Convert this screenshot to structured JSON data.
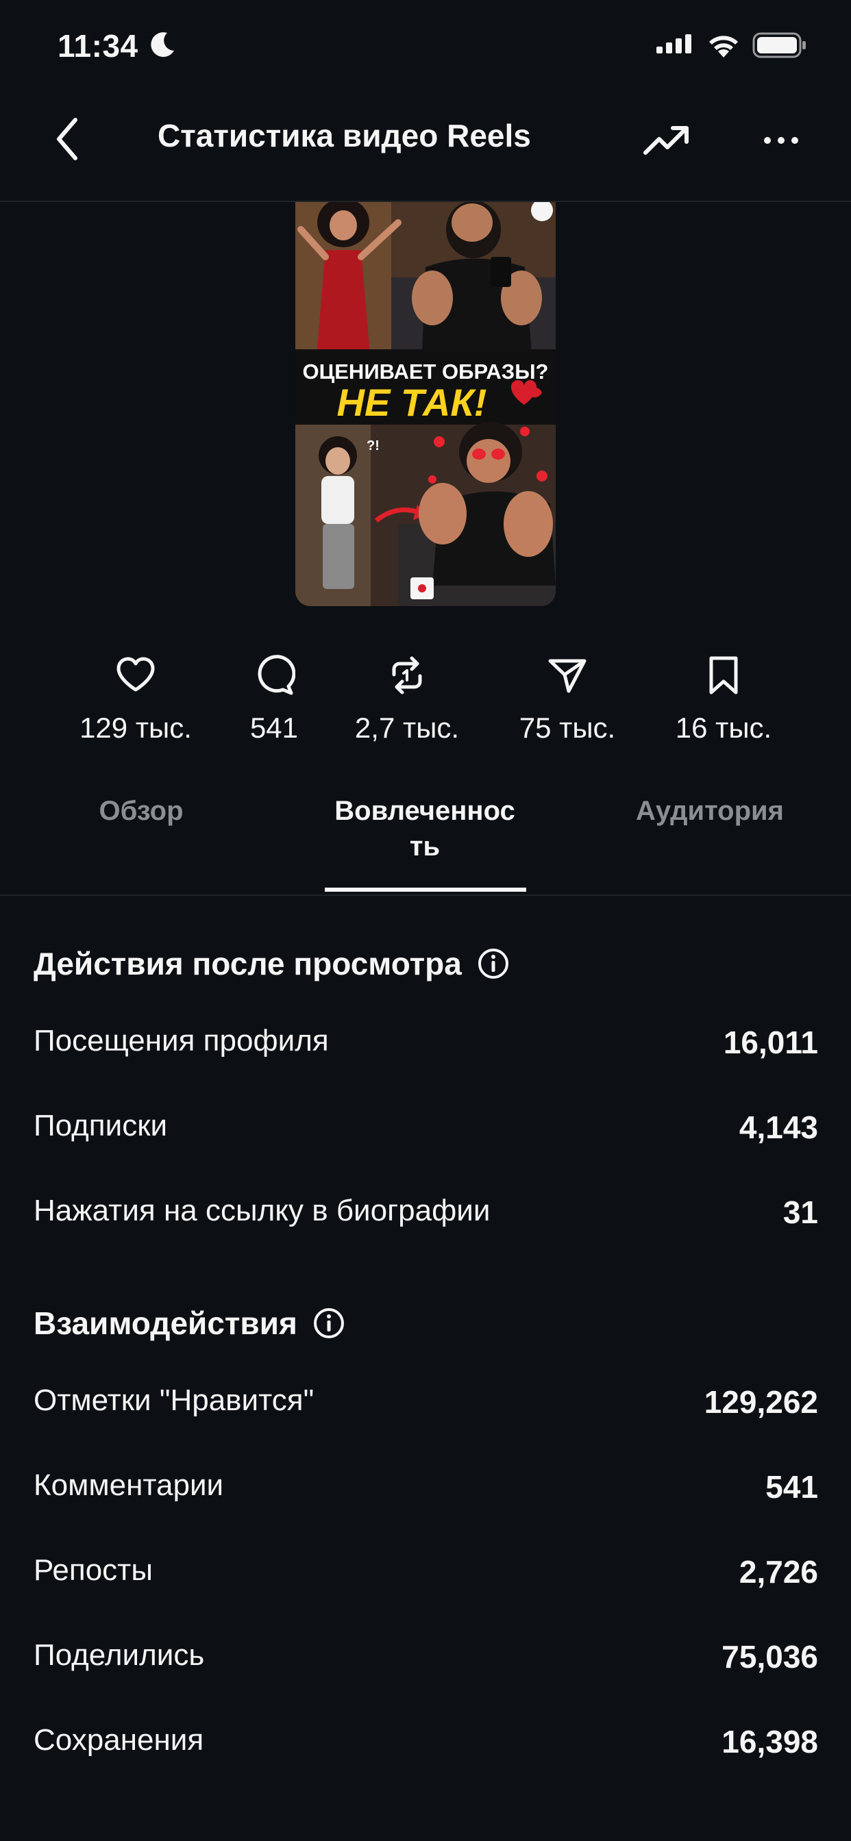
{
  "status_bar": {
    "time": "11:34"
  },
  "nav": {
    "title": "Статистика видео Reels"
  },
  "thumbnail": {
    "caption_line1": "ОЦЕНИВАЕТ ОБРАЗЫ?",
    "caption_line2": "НЕ ТАК!",
    "badge": "?!"
  },
  "counters": [
    {
      "icon": "heart-icon",
      "value": "129 тыс."
    },
    {
      "icon": "comment-icon",
      "value": "541"
    },
    {
      "icon": "repost-icon",
      "value": "2,7 тыс."
    },
    {
      "icon": "share-icon",
      "value": "75 тыс."
    },
    {
      "icon": "bookmark-icon",
      "value": "16 тыс."
    }
  ],
  "tabs": {
    "overview": "Обзор",
    "engagement_line1": "Вовлеченнос",
    "engagement_line2": "ть",
    "audience": "Аудитория"
  },
  "actions": {
    "title": "Действия после просмотра",
    "rows": [
      {
        "label": "Посещения профиля",
        "value": "16,011"
      },
      {
        "label": "Подписки",
        "value": "4,143"
      },
      {
        "label": "Нажатия на ссылку в биографии",
        "value": "31"
      }
    ]
  },
  "interactions": {
    "title": "Взаимодействия",
    "rows": [
      {
        "label": "Отметки \"Нравится\"",
        "value": "129,262"
      },
      {
        "label": "Комментарии",
        "value": "541"
      },
      {
        "label": "Репосты",
        "value": "2,726"
      },
      {
        "label": "Поделились",
        "value": "75,036"
      },
      {
        "label": "Сохранения",
        "value": "16,398"
      }
    ]
  },
  "colors": {
    "background": "#0c1014",
    "text": "#f5f5f5",
    "muted": "#8a8f94",
    "divider": "#1f2428"
  }
}
